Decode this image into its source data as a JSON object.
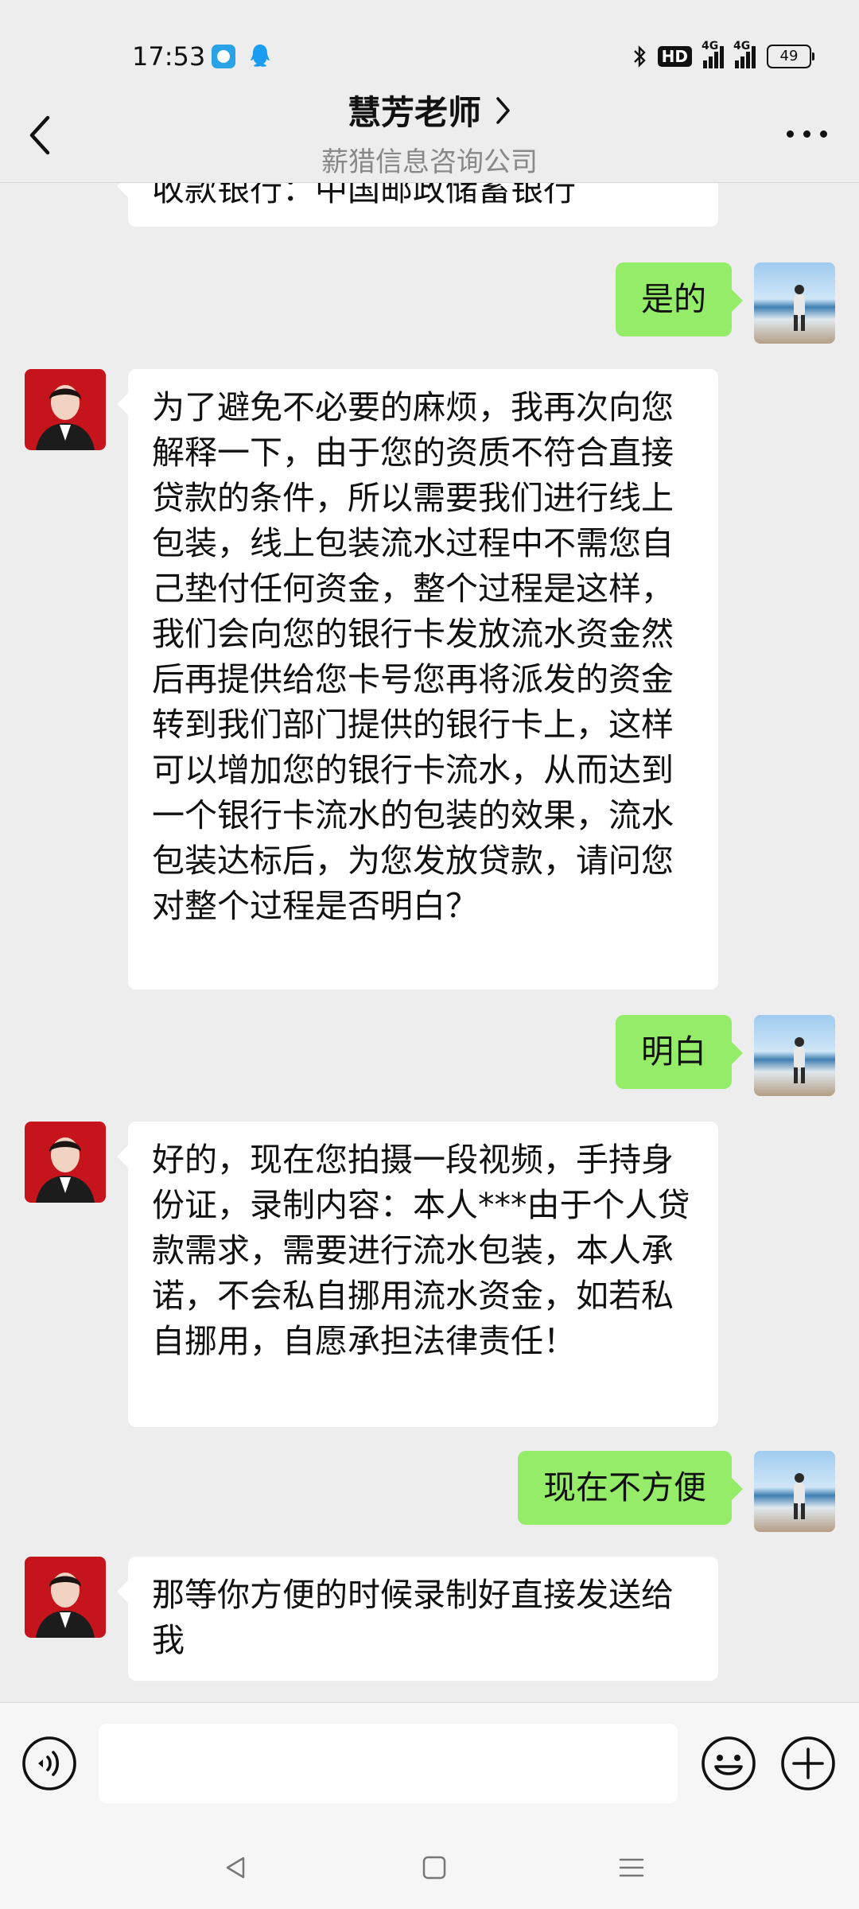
{
  "status_bar": {
    "time": "17:53",
    "hd_label": "HD",
    "network_1": "4G",
    "network_2": "4G",
    "battery": "49"
  },
  "header": {
    "title": "慧芳老师",
    "subtitle": "薪猎信息咨询公司"
  },
  "messages": [
    {
      "side": "in",
      "text": "收款银行：中国邮政储蓄银行"
    },
    {
      "side": "out",
      "text": "是的"
    },
    {
      "side": "in",
      "text": "为了避免不必要的麻烦，我再次向您解释一下，由于您的资质不符合直接贷款的条件，所以需要我们进行线上包装，线上包装流水过程中不需您自己垫付任何资金，整个过程是这样，我们会向您的银行卡发放流水资金然后再提供给您卡号您再将派发的资金转到我们部门提供的银行卡上，这样可以增加您的银行卡流水，从而达到一个银行卡流水的包装的效果，流水包装达标后，为您发放贷款，请问您对整个过程是否明白？"
    },
    {
      "side": "out",
      "text": "明白"
    },
    {
      "side": "in",
      "text": "好的，现在您拍摄一段视频，手持身份证，录制内容：本人***由于个人贷款需求，需要进行流水包装，本人承诺，不会私自挪用流水资金，如若私自挪用，自愿承担法律责任！"
    },
    {
      "side": "out",
      "text": "现在不方便"
    },
    {
      "side": "in",
      "text": "那等你方便的时候录制好直接发送给我"
    }
  ],
  "input": {
    "value": "",
    "placeholder": ""
  },
  "icons": {
    "back": "chevron-left-icon",
    "more": "more-dots-icon",
    "voice": "voice-icon",
    "emoji": "emoji-icon",
    "plus": "plus-icon"
  },
  "colors": {
    "background": "#ededed",
    "incoming_bubble": "#ffffff",
    "outgoing_bubble": "#95ec69",
    "subtitle": "#888888"
  }
}
